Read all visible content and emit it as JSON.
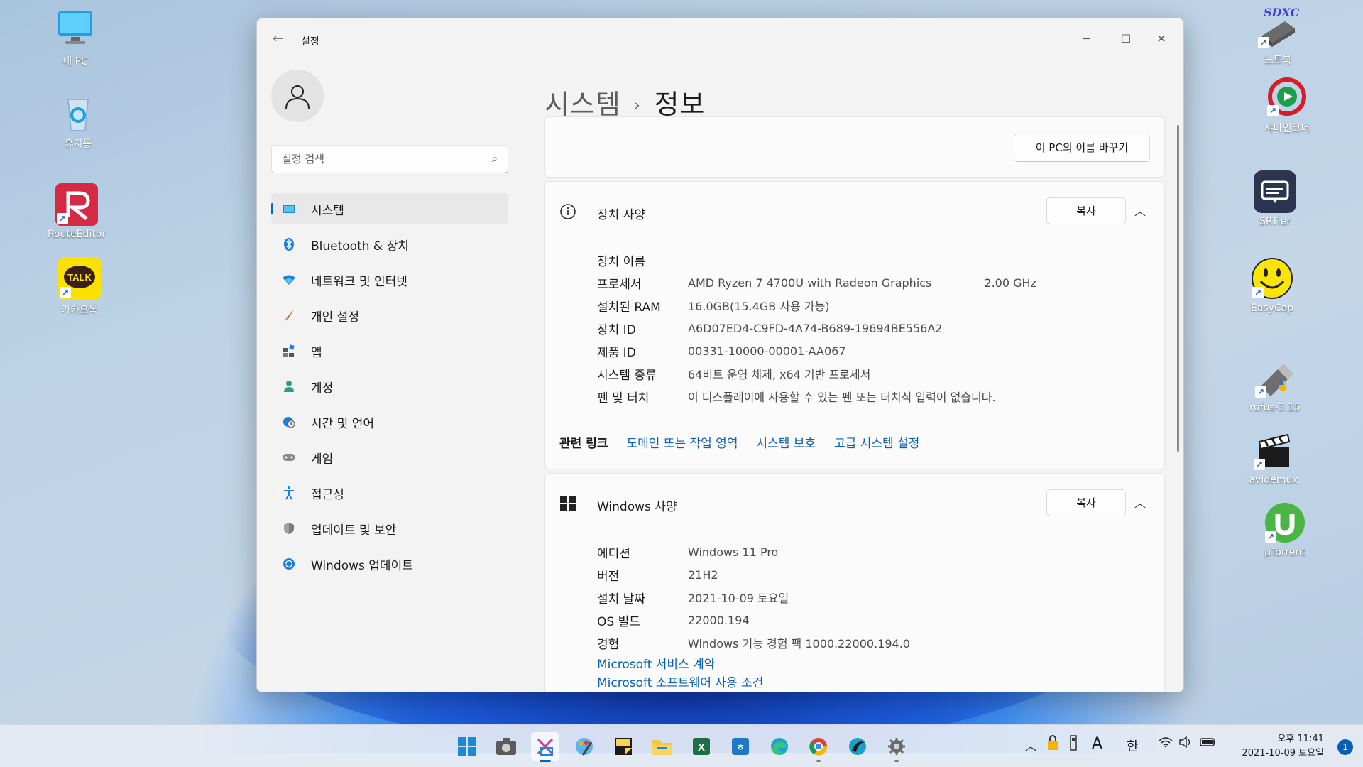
{
  "desktop": {
    "left_icons": [
      {
        "label": "내 PC"
      },
      {
        "label": "휴지통"
      },
      {
        "label": "RouteEditor"
      },
      {
        "label": "카카오톡"
      }
    ],
    "right_icons": [
      {
        "label": "노트북",
        "badge": "SDXC"
      },
      {
        "label": "샤나인코더"
      },
      {
        "label": "SRTier"
      },
      {
        "label": "EasyCap"
      },
      {
        "label": "rufus-3.15"
      },
      {
        "label": "avidemux"
      },
      {
        "label": "µTorrent"
      }
    ]
  },
  "window": {
    "app_title": "설정",
    "controls": {
      "minimize": "─",
      "maximize": "☐",
      "close": "✕"
    }
  },
  "nav": {
    "search_placeholder": "설정 검색",
    "items": [
      {
        "label": "시스템",
        "icon": "monitor-icon",
        "active": true
      },
      {
        "label": "Bluetooth & 장치",
        "icon": "bluetooth-icon"
      },
      {
        "label": "네트워크 및 인터넷",
        "icon": "wifi-icon"
      },
      {
        "label": "개인 설정",
        "icon": "brush-icon"
      },
      {
        "label": "앱",
        "icon": "apps-icon"
      },
      {
        "label": "계정",
        "icon": "person-icon"
      },
      {
        "label": "시간 및 언어",
        "icon": "globe-clock-icon"
      },
      {
        "label": "게임",
        "icon": "gamepad-icon"
      },
      {
        "label": "접근성",
        "icon": "accessibility-icon"
      },
      {
        "label": "업데이트 및 보안",
        "icon": "shield-icon"
      },
      {
        "label": "Windows 업데이트",
        "icon": "update-icon"
      }
    ]
  },
  "page": {
    "breadcrumb_parent": "시스템",
    "breadcrumb_sep": "›",
    "breadcrumb_current": "정보",
    "rename_button": "이 PC의 이름 바꾸기"
  },
  "device_specs": {
    "title": "장치 사양",
    "copy_button": "복사",
    "rows": [
      {
        "key": "장치 이름",
        "value": ""
      },
      {
        "key": "프로세서",
        "value": "AMD Ryzen 7 4700U with Radeon Graphics",
        "extra": "2.00 GHz"
      },
      {
        "key": "설치된 RAM",
        "value": "16.0GB(15.4GB 사용 가능)"
      },
      {
        "key": "장치 ID",
        "value": "A6D07ED4-C9FD-4A74-B689-19694BE556A2"
      },
      {
        "key": "제품 ID",
        "value": "00331-10000-00001-AA067"
      },
      {
        "key": "시스템 종류",
        "value": "64비트 운영 체제, x64 기반 프로세서"
      },
      {
        "key": "펜 및 터치",
        "value": "이 디스플레이에 사용할 수 있는 펜 또는 터치식 입력이 없습니다."
      }
    ]
  },
  "related_links": {
    "title": "관련 링크",
    "links": [
      "도메인 또는 작업 영역",
      "시스템 보호",
      "고급 시스템 설정"
    ]
  },
  "windows_specs": {
    "title": "Windows 사양",
    "copy_button": "복사",
    "rows": [
      {
        "key": "에디션",
        "value": "Windows 11 Pro"
      },
      {
        "key": "버전",
        "value": "21H2"
      },
      {
        "key": "설치 날짜",
        "value": "2021-10-09 토요일"
      },
      {
        "key": "OS 빌드",
        "value": "22000.194"
      },
      {
        "key": "경험",
        "value": "Windows 기능 경험 팩 1000.22000.194.0"
      }
    ],
    "links": [
      "Microsoft 서비스 계약",
      "Microsoft 소프트웨어 사용 조건"
    ]
  },
  "taskbar": {
    "apps": [
      "start-icon",
      "camera-icon",
      "snipping-tool-icon",
      "paint-icon",
      "sticky-notes-icon",
      "file-explorer-icon",
      "excel-icon",
      "hangul-icon",
      "edge-icon",
      "chrome-icon",
      "app-icon",
      "settings-icon"
    ],
    "tray": {
      "ime_mode": "A",
      "ime_lang": "한"
    },
    "clock": {
      "time": "오후 11:41",
      "date": "2021-10-09 토요일"
    },
    "notification_count": "1"
  },
  "colors": {
    "accent": "#0067c0",
    "link": "#0a5fb4"
  }
}
